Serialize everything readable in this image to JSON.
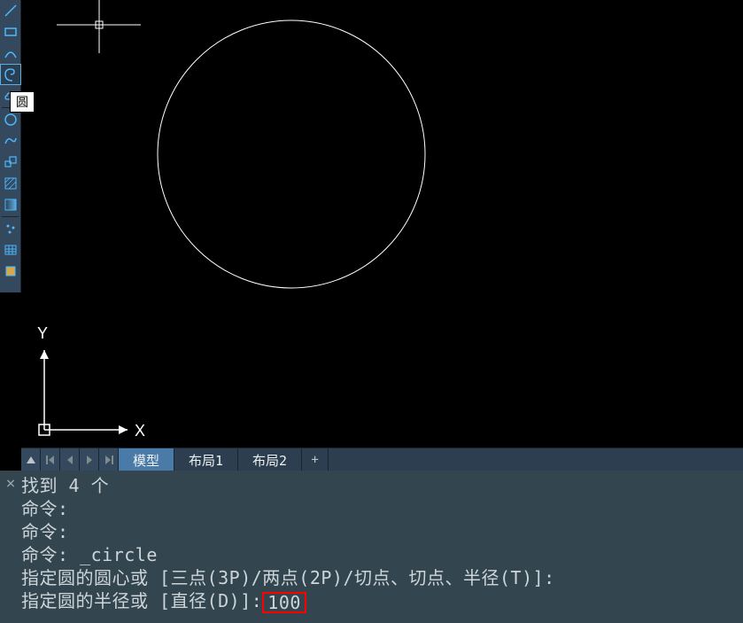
{
  "tooltip": "圆",
  "tabs": {
    "model": "模型",
    "layout1": "布局1",
    "layout2": "布局2",
    "add": "+"
  },
  "ucs": {
    "x_label": "X",
    "y_label": "Y"
  },
  "command": {
    "line1": "找到 4 个",
    "line2": "命令:",
    "line3": "命令:",
    "line4": "命令: _circle",
    "line5": "指定圆的圆心或 [三点(3P)/两点(2P)/切点、切点、半径(T)]:",
    "line6_prefix": "指定圆的半径或 [直径(D)]:",
    "line6_input": "100"
  },
  "tool_icons": {
    "line": "line-icon",
    "rect": "rectangle-icon",
    "arc": "arc-icon",
    "spiral": "spiral-icon",
    "cloud": "cloud-icon",
    "circle": "circle-icon",
    "curve": "curve-icon",
    "scale": "scale-icon",
    "hatch": "hatch-icon",
    "gradient": "gradient-icon",
    "point": "point-icon",
    "table": "table-icon",
    "region": "region-icon"
  }
}
